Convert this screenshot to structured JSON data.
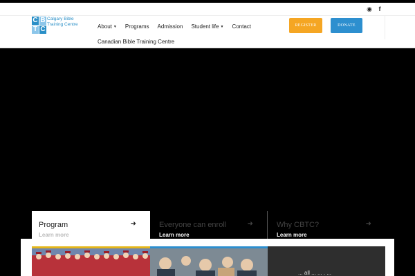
{
  "colors": {
    "accent_blue": "#2d8fcf",
    "register_orange": "#f5a623",
    "logo_blue": "#2a8fc7",
    "logo_light": "#8cc6ea",
    "gold": "#e4b61a",
    "dark": "#000000"
  },
  "utility": {
    "icons": [
      "globe-icon",
      "facebook-icon"
    ],
    "globe_glyph": "◉",
    "facebook_glyph": "f"
  },
  "logo": {
    "letters": [
      "C",
      "B",
      "T",
      "C"
    ],
    "line1": "Calgary Bible",
    "line2": "Training Centre"
  },
  "nav": {
    "items": [
      {
        "label": "About",
        "has_caret": true
      },
      {
        "label": "Programs",
        "has_caret": false
      },
      {
        "label": "Admission",
        "has_caret": false
      },
      {
        "label": "Student life",
        "has_caret": true
      },
      {
        "label": "Contact",
        "has_caret": false
      }
    ],
    "caret": "▼",
    "secondary": "Canadian Bible Training Centre"
  },
  "buttons": {
    "register": "REGISTER",
    "donate": "DONATE"
  },
  "tabs": [
    {
      "title": "Program",
      "learn": "Learn more",
      "active": true
    },
    {
      "title": "Everyone can enroll",
      "learn": "Learn more",
      "active": false
    },
    {
      "title": "Why CBTC?",
      "learn": "Learn more",
      "active": false
    }
  ],
  "arrow": "➜",
  "card3_caption": "... all ... ... . ..."
}
